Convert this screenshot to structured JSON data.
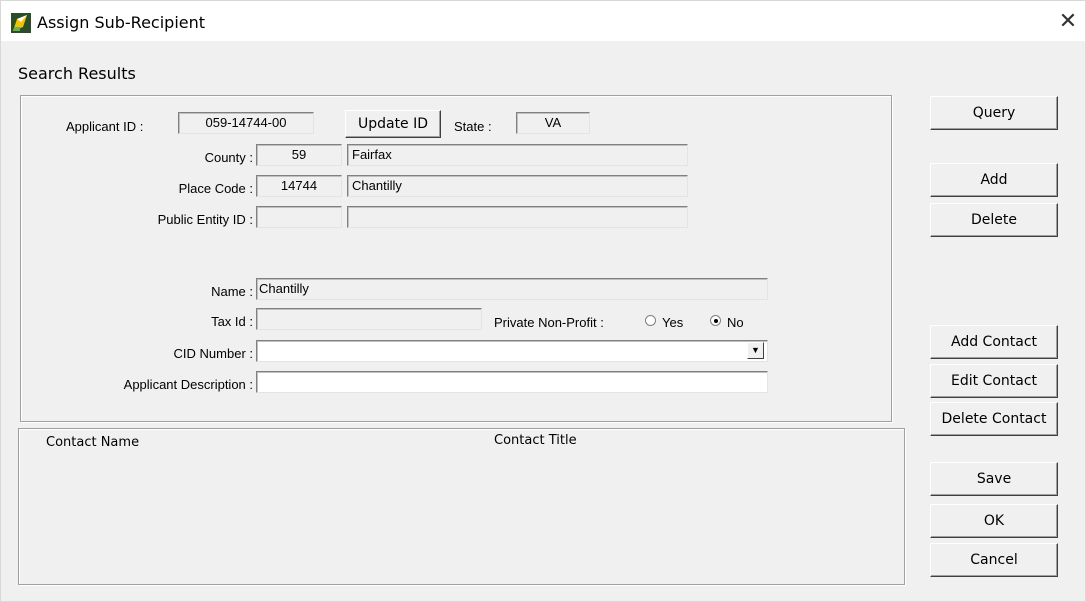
{
  "window": {
    "title": "Assign Sub-Recipient",
    "close_glyph": "✕"
  },
  "section_title": "Search Results",
  "applicant": {
    "id_label": "Applicant ID :",
    "id_value": "059-14744-00",
    "update_id_label": "Update ID",
    "state_label": "State :",
    "state_value": "VA",
    "county_label": "County :",
    "county_code": "59",
    "county_name": "Fairfax",
    "place_code_label": "Place Code :",
    "place_code": "14744",
    "place_name": "Chantilly",
    "public_entity_label": "Public Entity ID :",
    "public_entity_code": "",
    "public_entity_name": "",
    "name_label": "Name :",
    "name_value": "Chantilly",
    "tax_id_label": "Tax Id :",
    "tax_id_value": "",
    "private_nonprofit_label": "Private Non-Profit :",
    "yes_label": "Yes",
    "no_label": "No",
    "private_nonprofit_selected": "No",
    "cid_label": "CID Number :",
    "cid_value": "",
    "description_label": "Applicant Description :",
    "description_value": ""
  },
  "contacts": {
    "columns": [
      "Contact Name",
      "Contact Title"
    ],
    "rows": []
  },
  "buttons": {
    "query": "Query",
    "add": "Add",
    "delete": "Delete",
    "add_contact": "Add  Contact",
    "edit_contact": "Edit Contact",
    "delete_contact": "Delete Contact",
    "save": "Save",
    "ok": "OK",
    "cancel": "Cancel"
  },
  "icons": {
    "app": "pencil-grant-icon",
    "close": "close-icon",
    "dropdown": "chevron-down-icon"
  }
}
